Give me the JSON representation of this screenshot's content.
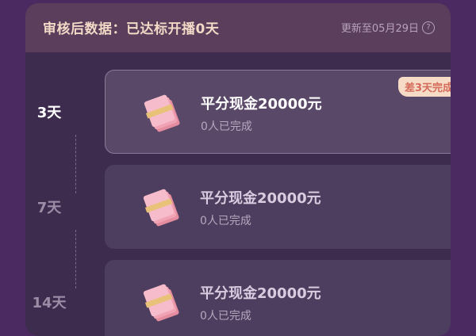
{
  "header": {
    "title": "审核后数据：已达标开播0天",
    "update_text": "更新至05月29日",
    "info_icon_glyph": "?"
  },
  "rewards": [
    {
      "day": "3天",
      "title": "平分现金20000元",
      "sub": "0人已完成",
      "badge": "差3天完成",
      "active": true
    },
    {
      "day": "7天",
      "title": "平分现金20000元",
      "sub": "0人已完成",
      "badge": "",
      "active": false
    },
    {
      "day": "14天",
      "title": "平分现金20000元",
      "sub": "0人已完成",
      "badge": "",
      "active": false
    }
  ],
  "colors": {
    "background": "#4a2a60",
    "header_text": "#f2d9c6",
    "badge_text": "#d46b5a",
    "badge_bg": "#f6dbc6"
  }
}
